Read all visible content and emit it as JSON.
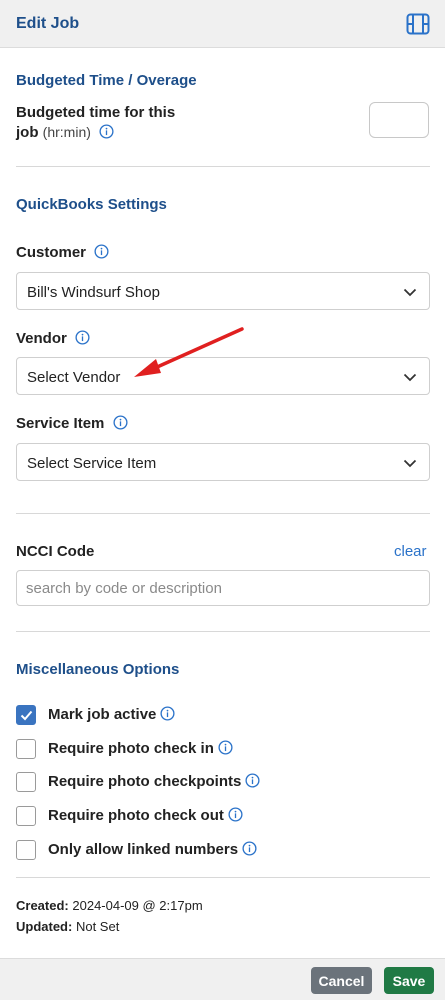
{
  "header": {
    "title": "Edit Job",
    "panel_icon": "sidebar-panel-icon"
  },
  "budget": {
    "section_title": "Budgeted Time / Overage",
    "label_line1": "Budgeted time for this",
    "label_line2": "job",
    "unit": "(hr:min)",
    "value": ""
  },
  "quickbooks": {
    "section_title": "QuickBooks Settings",
    "customer_label": "Customer",
    "customer_value": "Bill's Windsurf Shop",
    "vendor_label": "Vendor",
    "vendor_value": "Select Vendor",
    "service_label": "Service Item",
    "service_value": "Select Service Item"
  },
  "ncci": {
    "label": "NCCI Code",
    "clear_label": "clear",
    "placeholder": "search by code or description"
  },
  "misc": {
    "section_title": "Miscellaneous Options",
    "options": [
      {
        "label": "Mark job active",
        "checked": true
      },
      {
        "label": "Require photo check in",
        "checked": false
      },
      {
        "label": "Require photo checkpoints",
        "checked": false
      },
      {
        "label": "Require photo check out",
        "checked": false
      },
      {
        "label": "Only allow linked numbers",
        "checked": false
      }
    ]
  },
  "meta": {
    "created_label": "Created:",
    "created_value": "2024-04-09 @ 2:17pm",
    "updated_label": "Updated:",
    "updated_value": "Not Set"
  },
  "footer": {
    "cancel_label": "Cancel",
    "save_label": "Save"
  },
  "colors": {
    "accent": "#1e4f8a",
    "link": "#2a72c9",
    "save": "#207a45",
    "cancel": "#6b737b",
    "annotation_arrow": "#e02020"
  }
}
